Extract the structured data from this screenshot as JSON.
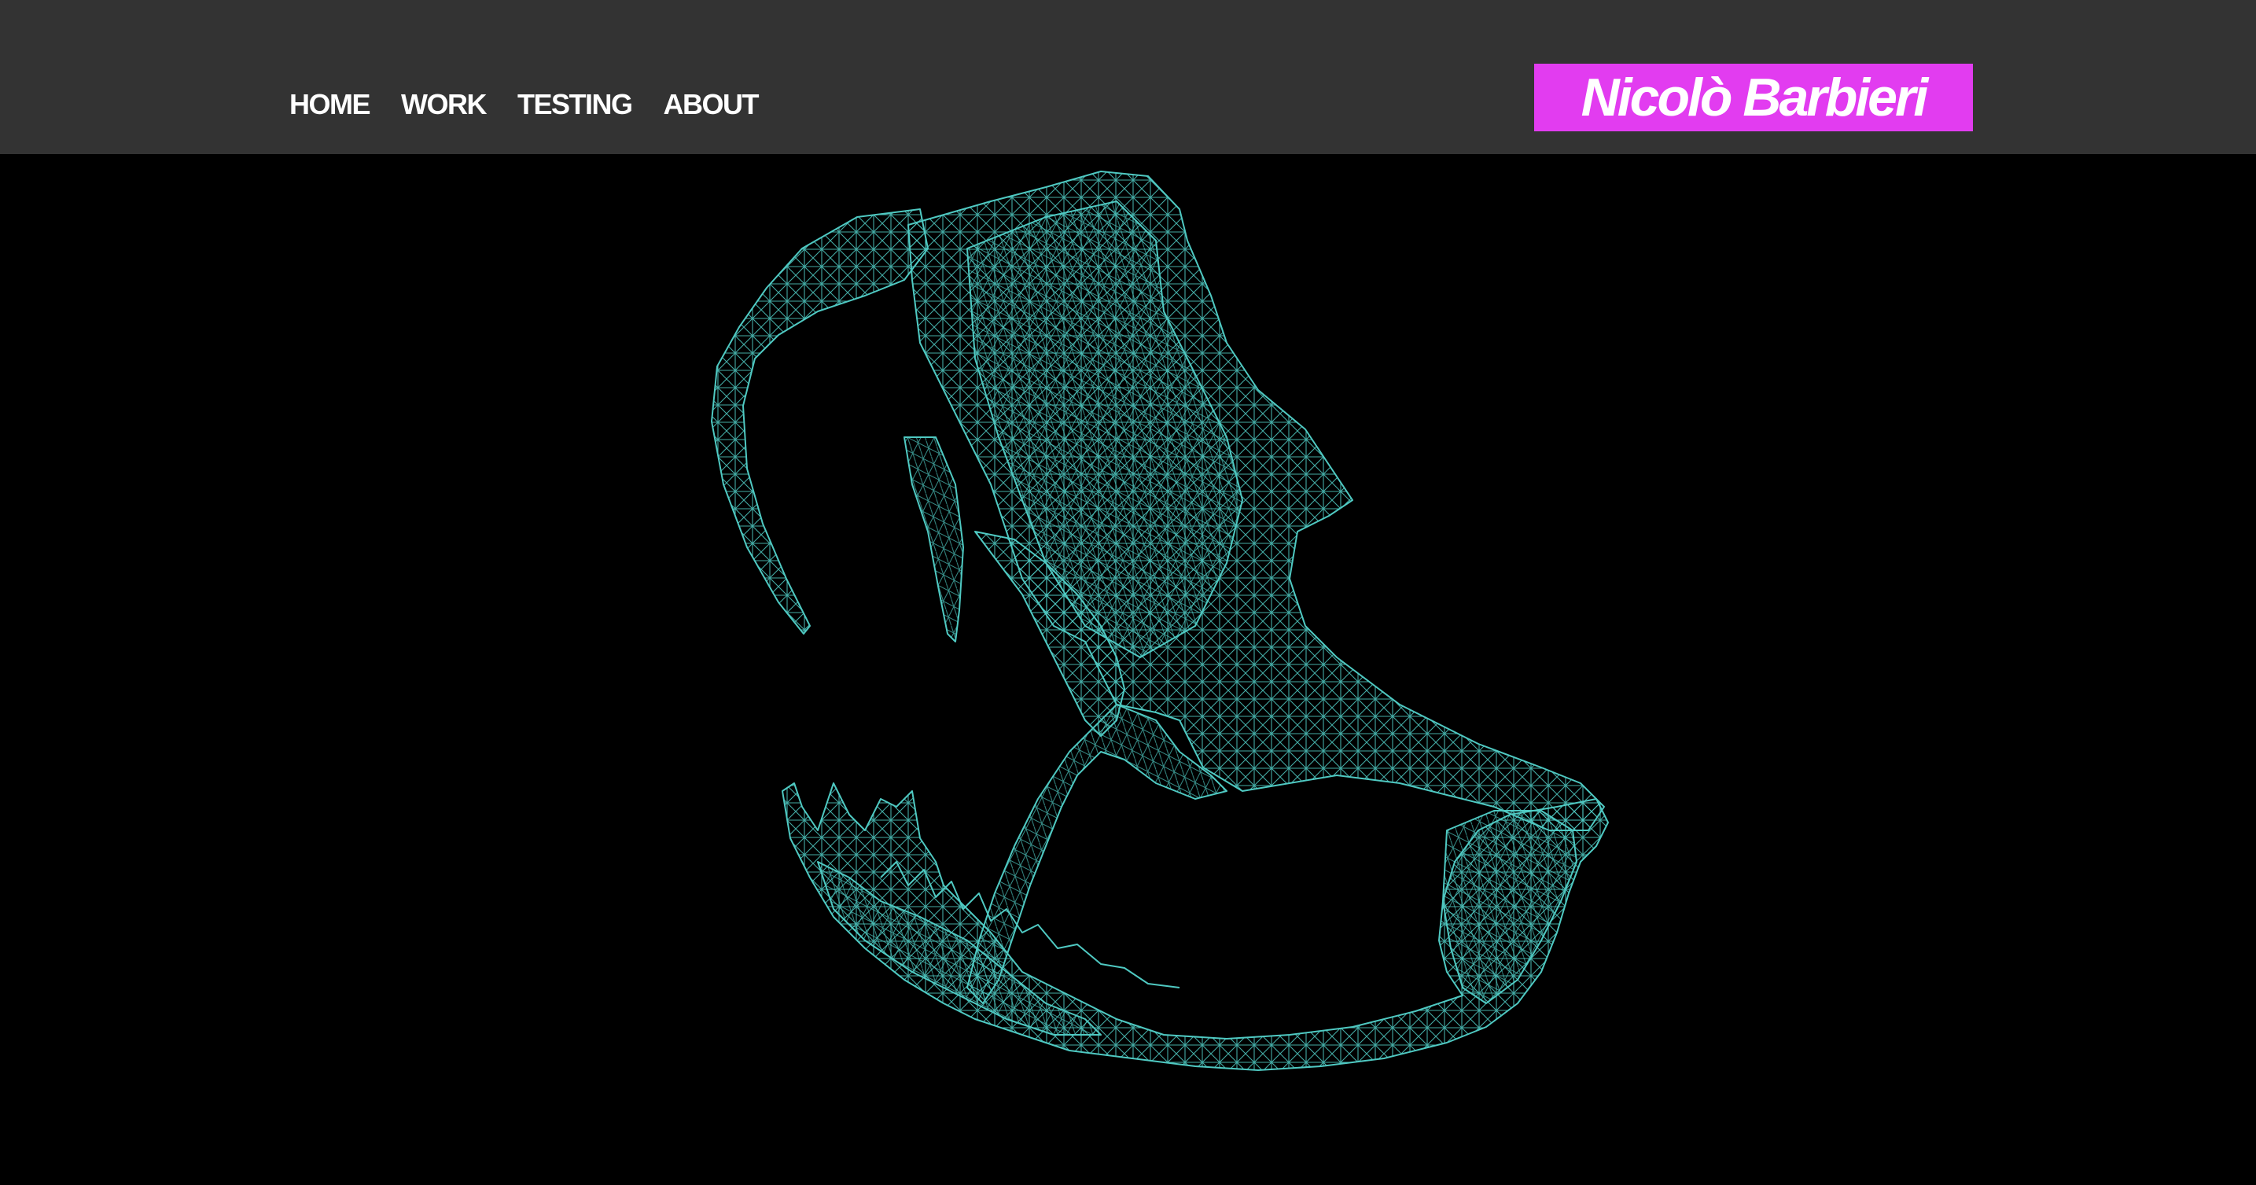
{
  "nav": {
    "items": [
      {
        "label": "HOME"
      },
      {
        "label": "WORK"
      },
      {
        "label": "TESTING"
      },
      {
        "label": "ABOUT"
      }
    ]
  },
  "brand": {
    "name": "Nicolò Barbieri"
  },
  "colors": {
    "header_bg": "#333333",
    "page_bg": "#000000",
    "nav_text": "#ffffff",
    "brand_bg": "#e23cf0",
    "wireframe": "#4fc9c2"
  },
  "icons": {
    "hero": "wireframe-skull-icon"
  }
}
